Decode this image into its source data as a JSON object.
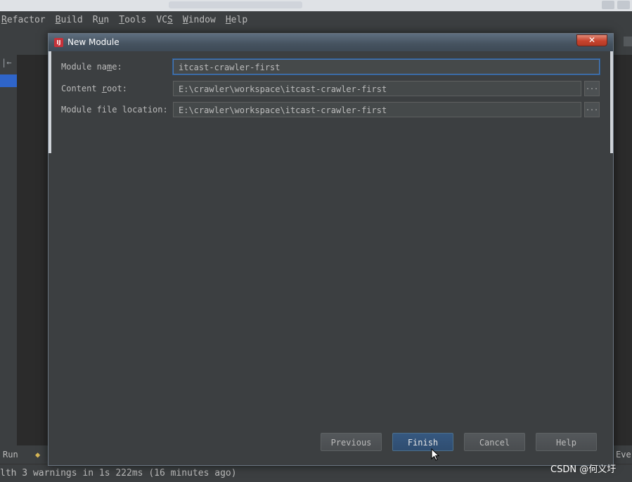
{
  "menubar": {
    "items": [
      "Refactor",
      "Build",
      "Run",
      "Tools",
      "VCS",
      "Window",
      "Help"
    ]
  },
  "dialog": {
    "title": "New Module",
    "close_symbol": "✕",
    "fields": {
      "module_name": {
        "label": "Module name:",
        "value": "itcast-crawler-first"
      },
      "content_root": {
        "label": "Content root:",
        "value": "E:\\crawler\\workspace\\itcast-crawler-first"
      },
      "module_file_location": {
        "label": "Module file location:",
        "value": "E:\\crawler\\workspace\\itcast-crawler-first"
      }
    },
    "browse_label": "...",
    "buttons": {
      "previous": "Previous",
      "finish": "Finish",
      "cancel": "Cancel",
      "help": "Help"
    }
  },
  "bottom_tools": {
    "run": "Run",
    "event_log": "Eve"
  },
  "statusbar": {
    "message": "lth 3 warnings in 1s 222ms (16 minutes ago)"
  },
  "watermark": "CSDN @何义圩",
  "colors": {
    "accent": "#365880",
    "focus": "#4a7ab8",
    "close": "#c7432d"
  },
  "icons": {
    "app": "intellij-icon",
    "cursor": "mouse-pointer-icon"
  }
}
